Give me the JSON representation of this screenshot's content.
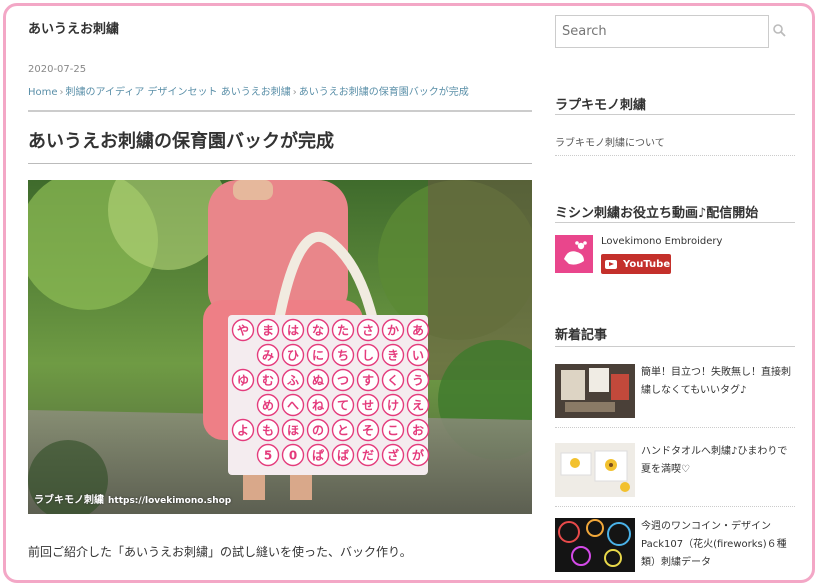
{
  "site": {
    "title": "あいうえお刺繍"
  },
  "post": {
    "date": "2020-07-25",
    "breadcrumb": [
      "Home",
      "刺繍のアイディア デザインセット あいうえお刺繍",
      "あいうえお刺繍の保育園バックが完成"
    ],
    "title": "あいうえお刺繍の保育園バックが完成",
    "image_watermark": "ラブキモノ刺繍",
    "image_watermark_url": "https://lovekimono.shop",
    "excerpt": "前回ご紹介した「あいうえお刺繍」の試し縫いを使った、バック作り。",
    "bag_letters": [
      [
        "や",
        "ま",
        "は",
        "な",
        "た",
        "さ",
        "か",
        "あ"
      ],
      [
        "",
        "み",
        "ひ",
        "に",
        "ち",
        "し",
        "き",
        "い"
      ],
      [
        "ゆ",
        "む",
        "ふ",
        "ぬ",
        "つ",
        "す",
        "く",
        "う"
      ],
      [
        "",
        "め",
        "へ",
        "ね",
        "て",
        "せ",
        "け",
        "え"
      ],
      [
        "よ",
        "も",
        "ほ",
        "の",
        "と",
        "そ",
        "こ",
        "お"
      ],
      [
        "",
        "5",
        "0",
        "ぱ",
        "ば",
        "だ",
        "ざ",
        "が"
      ]
    ]
  },
  "sidebar": {
    "search_placeholder": "Search",
    "widget1": {
      "title": "ラプキモノ刺繍",
      "link": "ラブキモノ刺繍について"
    },
    "widget2": {
      "title": "ミシン刺繍お役立ち動画♪配信開始",
      "channel_name": "Lovekimono Embroidery",
      "button_label": "YouTube"
    },
    "widget3": {
      "title": "新着記事",
      "items": [
        {
          "title": "簡単！目立つ！失敗無し！直接刺繍しなくてもいいタグ♪"
        },
        {
          "title": "ハンドタオルへ刺繍♪ひまわりで夏を満喫♡"
        },
        {
          "title": "今週のワンコイン・デザイン Pack107（花火(fireworks)６種類）刺繍データ"
        }
      ]
    }
  },
  "colors": {
    "frame": "#f3a7c6",
    "link": "#5a8fa8",
    "youtube": "#c4302b",
    "accent_pink": "#e9468c"
  }
}
